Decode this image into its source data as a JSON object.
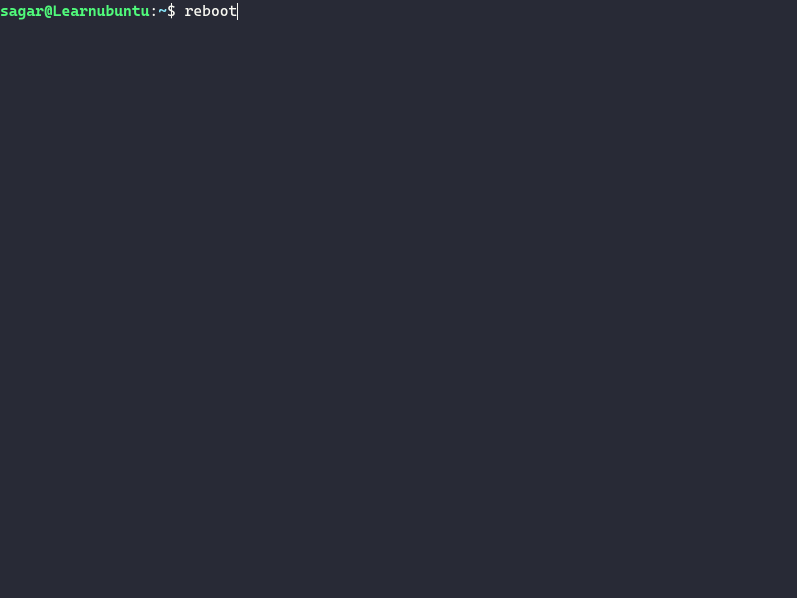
{
  "prompt": {
    "user_host": "sagar@Learnubuntu",
    "separator": ":",
    "path": "~",
    "symbol": "$ ",
    "command": "reboot"
  }
}
